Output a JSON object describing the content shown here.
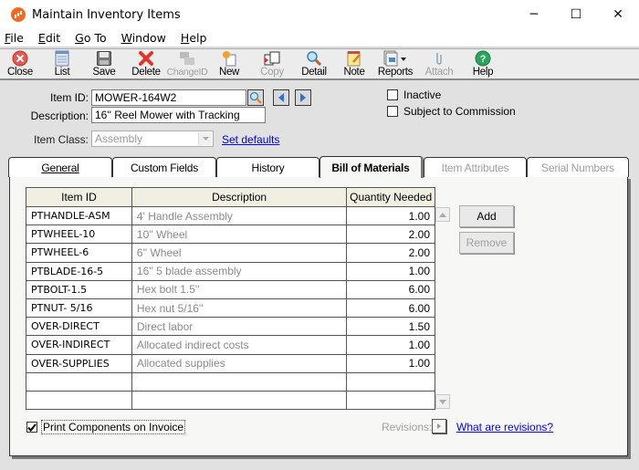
{
  "window": {
    "title": "Maintain Inventory Items",
    "controls": {
      "minimize": "─",
      "maximize": "☐",
      "close": "✕"
    }
  },
  "menu": [
    {
      "label": "File",
      "accel": "F",
      "rest": "ile"
    },
    {
      "label": "Edit",
      "accel": "E",
      "rest": "dit"
    },
    {
      "label": "Go To",
      "accel": "G",
      "rest": "o To"
    },
    {
      "label": "Window",
      "accel": "W",
      "rest": "indow"
    },
    {
      "label": "Help",
      "accel": "H",
      "rest": "elp"
    }
  ],
  "toolbar": [
    {
      "label": "Close",
      "icon": "close-icon",
      "enabled": true
    },
    {
      "label": "List",
      "icon": "list-icon",
      "enabled": true
    },
    {
      "label": "Save",
      "icon": "save-icon",
      "enabled": true
    },
    {
      "label": "Delete",
      "icon": "delete-icon",
      "enabled": true
    },
    {
      "label": "ChangeID",
      "icon": "change-id-icon",
      "enabled": false
    },
    {
      "label": "New",
      "icon": "new-icon",
      "enabled": true
    },
    {
      "label": "Copy",
      "icon": "copy-icon",
      "enabled": false
    },
    {
      "label": "Detail",
      "icon": "detail-icon",
      "enabled": true
    },
    {
      "label": "Note",
      "icon": "note-icon",
      "enabled": true
    },
    {
      "label": "Reports",
      "icon": "reports-icon",
      "enabled": true
    },
    {
      "label": "Attach",
      "icon": "attach-icon",
      "enabled": false
    },
    {
      "label": "Help",
      "icon": "help-icon",
      "enabled": true
    }
  ],
  "form": {
    "item_id_label": "Item ID:",
    "item_id_value": "MOWER-164W2",
    "description_label": "Description:",
    "description_value": "16'' Reel Mower with Tracking",
    "item_class_label": "Item Class:",
    "item_class_value": "Assembly",
    "set_defaults_link": "Set defaults",
    "inactive_label": "Inactive",
    "inactive_checked": false,
    "commission_label": "Subject to Commission",
    "commission_checked": false
  },
  "tabs": [
    {
      "label": "General",
      "state": "normal"
    },
    {
      "label": "Custom Fields",
      "state": "normal"
    },
    {
      "label": "History",
      "state": "normal"
    },
    {
      "label": "Bill of Materials",
      "state": "active"
    },
    {
      "label": "Item Attributes",
      "state": "disabled"
    },
    {
      "label": "Serial Numbers",
      "state": "disabled"
    }
  ],
  "bom": {
    "columns": [
      "Item ID",
      "Description",
      "Quantity Needed"
    ],
    "rows": [
      {
        "id": "PTHANDLE-ASM",
        "desc": "4' Handle Assembly",
        "qty": "1.00"
      },
      {
        "id": "PTWHEEL-10",
        "desc": "10'' Wheel",
        "qty": "2.00"
      },
      {
        "id": "PTWHEEL-6",
        "desc": "6'' Wheel",
        "qty": "2.00"
      },
      {
        "id": "PTBLADE-16-5",
        "desc": "16'' 5 blade assembly",
        "qty": "1.00"
      },
      {
        "id": "PTBOLT-1.5",
        "desc": "Hex bolt 1.5''",
        "qty": "6.00"
      },
      {
        "id": "PTNUT- 5/16",
        "desc": "Hex nut 5/16''",
        "qty": "6.00"
      },
      {
        "id": "OVER-DIRECT",
        "desc": "Direct labor",
        "qty": "1.50"
      },
      {
        "id": "OVER-INDIRECT",
        "desc": "Allocated indirect costs",
        "qty": "1.00"
      },
      {
        "id": "OVER-SUPPLIES",
        "desc": "Allocated supplies",
        "qty": "1.00"
      },
      {
        "id": "",
        "desc": "",
        "qty": ""
      },
      {
        "id": "",
        "desc": "",
        "qty": ""
      }
    ],
    "add_label": "Add",
    "remove_label": "Remove",
    "print_components_label": "Print Components on Invoice",
    "print_components_checked": true,
    "revisions_label": "Revisions:",
    "what_are_revisions_link": "What are revisions?"
  }
}
